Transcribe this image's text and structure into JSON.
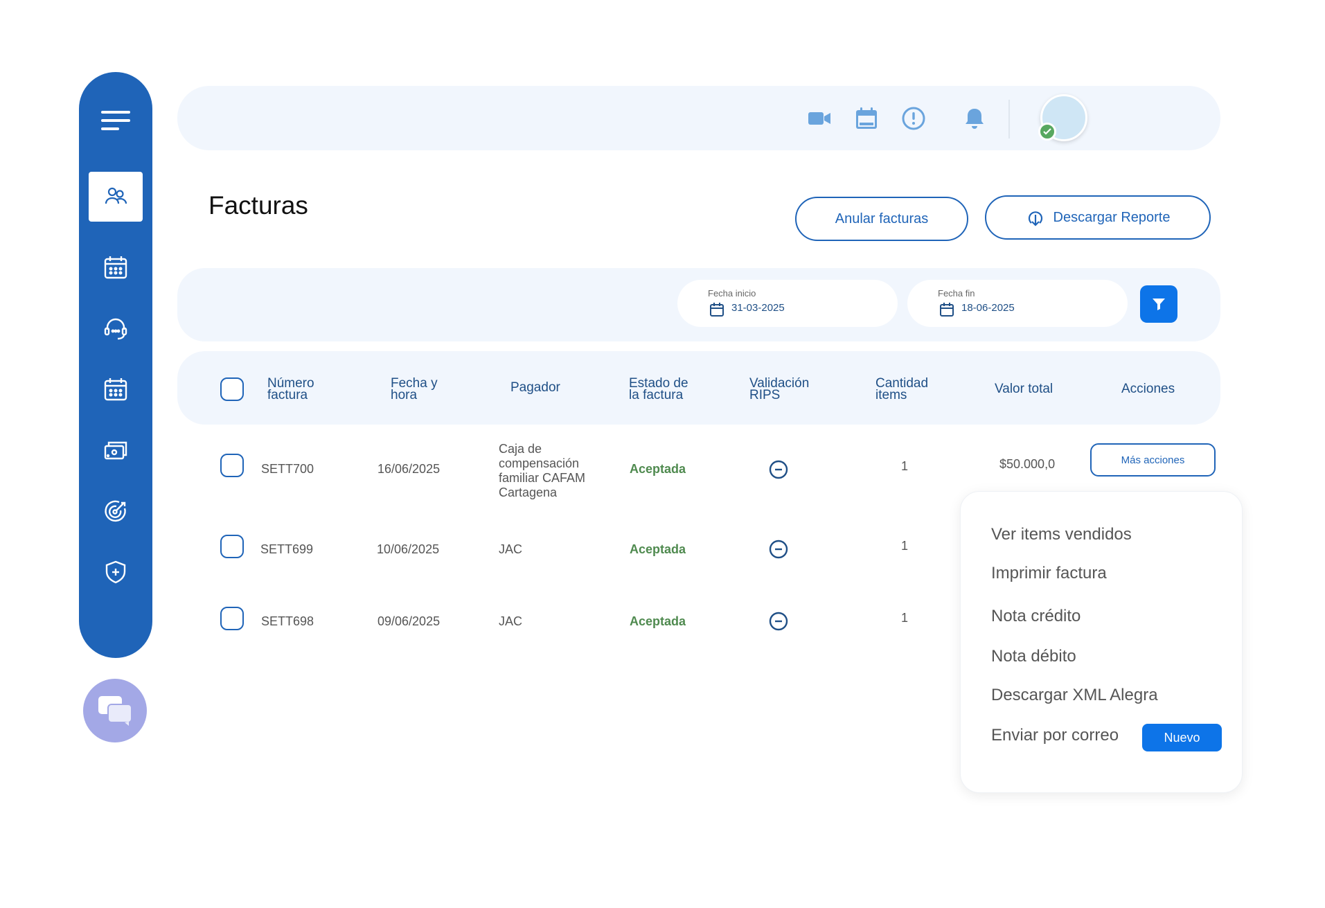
{
  "page": {
    "title": "Facturas"
  },
  "sidebar": {
    "items": [
      {
        "icon": "users-icon",
        "active": true
      },
      {
        "icon": "calendar-icon"
      },
      {
        "icon": "headset-icon"
      },
      {
        "icon": "calendar-grid-icon"
      },
      {
        "icon": "billing-icon"
      },
      {
        "icon": "target-icon"
      },
      {
        "icon": "shield-icon"
      }
    ]
  },
  "topbar": {
    "icons": [
      "video-icon",
      "calendar-icon",
      "alert-icon",
      "bell-icon"
    ]
  },
  "actions": {
    "anular": "Anular facturas",
    "descargar": "Descargar Reporte"
  },
  "filters": {
    "start_label": "Fecha inicio",
    "start_value": "31-03-2025",
    "end_label": "Fecha fin",
    "end_value": "18-06-2025"
  },
  "table": {
    "headers": {
      "numero": [
        "Número",
        "factura"
      ],
      "fecha": [
        "Fecha y",
        "hora"
      ],
      "pagador": "Pagador",
      "estado": [
        "Estado de",
        "la factura"
      ],
      "validacion": [
        "Validación",
        "RIPS"
      ],
      "cantidad": [
        "Cantidad",
        "items"
      ],
      "valor": "Valor total",
      "acciones": "Acciones"
    },
    "rows": [
      {
        "numero": "SETT700",
        "fecha": "16/06/2025",
        "pagador": [
          "Caja de",
          "compensación",
          "familiar CAFAM",
          "Cartagena"
        ],
        "estado": "Aceptada",
        "cantidad": "1",
        "valor": "$50.000,0",
        "accion": "Más acciones"
      },
      {
        "numero": "SETT699",
        "fecha": "10/06/2025",
        "pagador": [
          "JAC"
        ],
        "estado": "Aceptada",
        "cantidad": "1"
      },
      {
        "numero": "SETT698",
        "fecha": "09/06/2025",
        "pagador": [
          "JAC"
        ],
        "estado": "Aceptada",
        "cantidad": "1"
      }
    ]
  },
  "menu": {
    "items": [
      "Ver items vendidos",
      "Imprimir factura",
      "Nota crédito",
      "Nota débito",
      "Descargar XML Alegra",
      "Enviar por correo"
    ],
    "badge": "Nuevo"
  },
  "colors": {
    "primary": "#1f64b8",
    "accent": "#0d74e8",
    "surface": "#f1f6fd",
    "success": "#4f8a4f"
  }
}
